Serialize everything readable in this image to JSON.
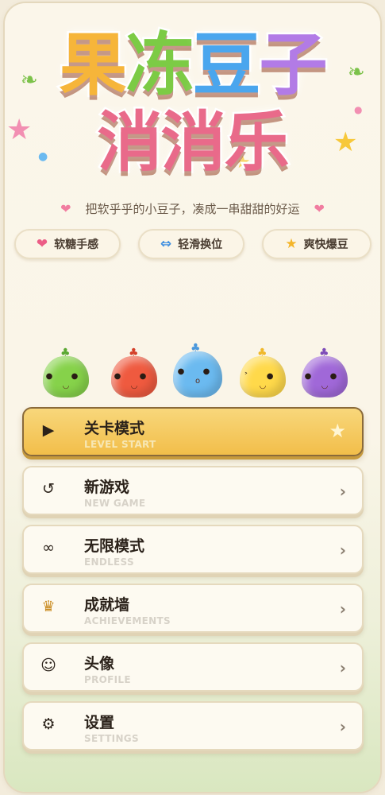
{
  "title": {
    "line1": [
      "果",
      "冻",
      "豆",
      "子"
    ],
    "line1_colors": [
      "#f6b53a",
      "#7ccb45",
      "#4aa6ee",
      "#b27be6"
    ],
    "line2": [
      "消",
      "消",
      "乐"
    ],
    "line2_color": "#e96a8a"
  },
  "subtitle": "把软乎乎的小豆子，凑成一串甜甜的好运",
  "chips": [
    {
      "icon": "heart-icon",
      "glyph": "❤",
      "color": "#ec5d86",
      "label": "软糖手感"
    },
    {
      "icon": "swap-arrows-icon",
      "glyph": "⇔",
      "color": "#3f8fe0",
      "label": "轻滑换位"
    },
    {
      "icon": "star-icon",
      "glyph": "★",
      "color": "#f4b52a",
      "label": "爽快爆豆"
    }
  ],
  "mascots": [
    {
      "name": "green-bean-mascot",
      "color": "#86d24a"
    },
    {
      "name": "red-bean-mascot",
      "color": "#ef5a3f"
    },
    {
      "name": "blue-bean-mascot",
      "color": "#6bbaf0"
    },
    {
      "name": "yellow-bean-mascot",
      "color": "#ffd94a"
    },
    {
      "name": "purple-bean-mascot",
      "color": "#a068d8"
    }
  ],
  "menu": [
    {
      "id": "level-start",
      "icon": "play-icon",
      "glyph": "▶",
      "title": "关卡模式",
      "subtitle": "LEVEL START",
      "chevron": "★",
      "primary": true
    },
    {
      "id": "new-game",
      "icon": "refresh-icon",
      "glyph": "↺",
      "title": "新游戏",
      "subtitle": "NEW GAME",
      "chevron": "›"
    },
    {
      "id": "endless",
      "icon": "infinity-icon",
      "glyph": "∞",
      "title": "无限模式",
      "subtitle": "ENDLESS",
      "chevron": "›"
    },
    {
      "id": "achievements",
      "icon": "trophy-icon",
      "glyph": "🏆",
      "title": "成就墙",
      "subtitle": "ACHIEVEMENTS",
      "chevron": "›"
    },
    {
      "id": "profile",
      "icon": "smiley-icon",
      "glyph": "☺",
      "title": "头像",
      "subtitle": "PROFILE",
      "chevron": "›"
    },
    {
      "id": "settings",
      "icon": "gear-icon",
      "glyph": "⚙",
      "title": "设置",
      "subtitle": "SETTINGS",
      "chevron": "›"
    }
  ]
}
